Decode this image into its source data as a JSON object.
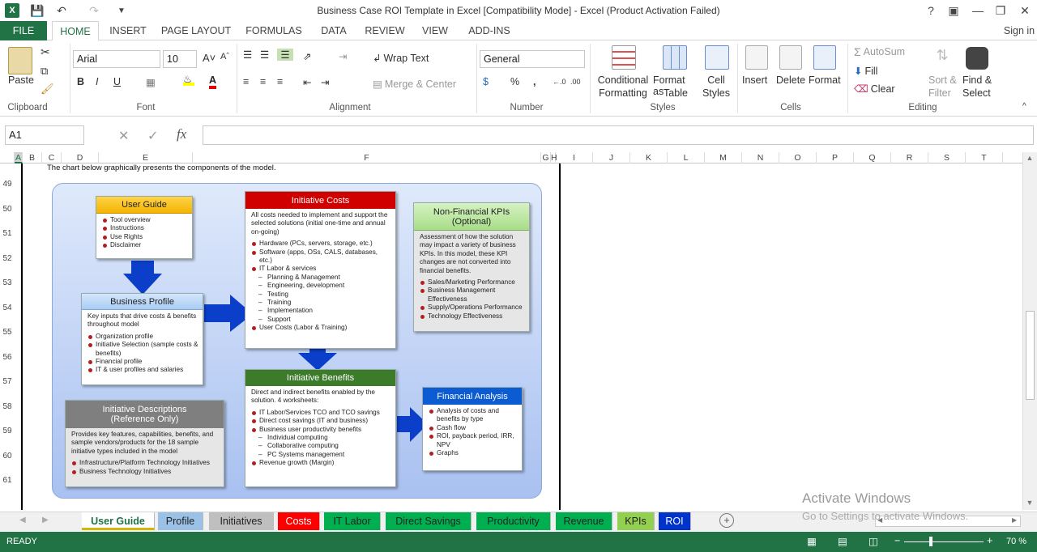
{
  "window": {
    "title": "Business Case ROI Template in Excel  [Compatibility Mode] - Excel (Product Activation Failed)",
    "sign_in": "Sign in"
  },
  "ribbon_tabs": [
    "FILE",
    "HOME",
    "INSERT",
    "PAGE LAYOUT",
    "FORMULAS",
    "DATA",
    "REVIEW",
    "VIEW",
    "ADD-INS"
  ],
  "clipboard": {
    "paste": "Paste",
    "group": "Clipboard"
  },
  "font": {
    "name": "Arial",
    "size": "10",
    "bold": "B",
    "italic": "I",
    "underline": "U",
    "group": "Font"
  },
  "alignment": {
    "wrap": "Wrap Text",
    "merge": "Merge & Center",
    "group": "Alignment"
  },
  "number": {
    "format": "General",
    "percent": "%",
    "comma": ",",
    "group": "Number"
  },
  "styles": {
    "conditional": "Conditional",
    "formatting": "Formatting",
    "format_as": "Format as",
    "table": "Table",
    "cell": "Cell",
    "styles_lbl": "Styles",
    "group": "Styles"
  },
  "cells": {
    "insert": "Insert",
    "delete": "Delete",
    "format": "Format",
    "group": "Cells"
  },
  "editing": {
    "autosum": "AutoSum",
    "fill": "Fill",
    "clear": "Clear",
    "sort": "Sort &",
    "filter": "Filter",
    "find": "Find &",
    "select": "Select",
    "group": "Editing"
  },
  "formula_bar": {
    "name_box": "A1",
    "fx": "fx",
    "value": ""
  },
  "columns": [
    "A",
    "B",
    "C",
    "D",
    "E",
    "F",
    "G",
    "H",
    "I",
    "J",
    "K",
    "L",
    "M",
    "N",
    "O",
    "P",
    "Q",
    "R",
    "S",
    "T"
  ],
  "rows": [
    "49",
    "50",
    "51",
    "52",
    "53",
    "54",
    "55",
    "56",
    "57",
    "58",
    "59",
    "60",
    "61"
  ],
  "sheet_text": "The chart below graphically presents the components of the model.",
  "diagram": {
    "user_guide": {
      "title": "User Guide",
      "items": [
        "Tool overview",
        "Instructions",
        "Use Rights",
        "Disclaimer"
      ]
    },
    "business_profile": {
      "title": "Business Profile",
      "intro": "Key inputs that drive costs & benefits throughout model",
      "items": [
        "Organization profile",
        "Initiative Selection (sample costs & benefits)",
        "Financial profile",
        "IT & user profiles and salaries"
      ]
    },
    "initiative_costs": {
      "title": "Initiative Costs",
      "intro": "All costs needed to implement and support the selected solutions (initial one-time and annual on-going)",
      "items": [
        "Hardware (PCs, servers, storage, etc.)",
        "Software (apps, OSs, CALS, databases, etc.)",
        "IT Labor & services"
      ],
      "sub": [
        "Planning & Management",
        "Engineering, development",
        "Testing",
        "Training",
        "Implementation",
        "Support"
      ],
      "last": "User Costs (Labor & Training)"
    },
    "non_financial": {
      "title": "Non-Financial KPIs (Optional)",
      "intro": "Assessment of how the solution may impact a variety of business KPIs.  In this model, these KPI changes are not converted into financial benefits.",
      "items": [
        "Sales/Marketing Performance",
        "Business Management Effectiveness",
        "Supply/Operations  Performance",
        "Technology Effectiveness"
      ]
    },
    "initiative_benefits": {
      "title": "Initiative Benefits",
      "intro": "Direct and indirect benefits enabled by the solution. 4 worksheets:",
      "items": [
        "IT Labor/Services  TCO and TCO savings",
        "Direct cost savings (IT and business)",
        "Business user productivity benefits"
      ],
      "sub": [
        "Individual computing",
        "Collaborative computing",
        "PC Systems management"
      ],
      "last": "Revenue growth (Margin)"
    },
    "financial_analysis": {
      "title": "Financial Analysis",
      "items": [
        "Analysis of costs and benefits by type",
        "Cash flow",
        "ROI, payback period, IRR, NPV",
        "Graphs"
      ]
    },
    "initiative_desc": {
      "title": "Initiative Descriptions (Reference Only)",
      "intro": "Provides key features, capabilities, benefits, and sample vendors/products for the 18 sample initiative types included in the model",
      "items": [
        "Infrastructure/Platform Technology Initiatives",
        "Business Technology Initiatives"
      ]
    }
  },
  "sheet_tabs": [
    "User Guide",
    "Profile",
    "Initiatives",
    "Costs",
    "IT Labor",
    "Direct Savings",
    "Productivity",
    "Revenue",
    "KPIs",
    "ROI"
  ],
  "watermark": {
    "line1": "Activate Windows",
    "line2": "Go to Settings to activate Windows."
  },
  "status": {
    "ready": "READY",
    "zoom": "70 %"
  },
  "colors": {
    "excel_green": "#217346",
    "accent_red": "#b21f1f"
  }
}
